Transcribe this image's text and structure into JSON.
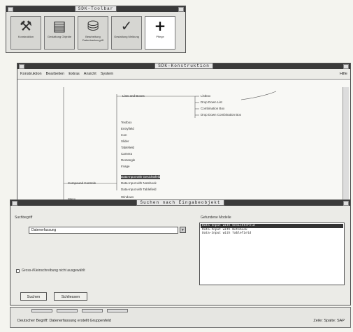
{
  "toolbar": {
    "title": "SDK-Toolbar",
    "tools": [
      {
        "label": "Konstruktion",
        "icon": "hammer-wrench-icon",
        "glyph": "⚒"
      },
      {
        "label": "Gestaltung Objekte",
        "icon": "notebook-icon",
        "glyph": "▤"
      },
      {
        "label": "Bearbeitung Datenbankzugriff",
        "icon": "disk-icon",
        "glyph": "⛁"
      },
      {
        "label": "Gestaltung Meldung",
        "icon": "check-icon",
        "glyph": "✓"
      },
      {
        "label": "Pflege",
        "icon": "plus-icon",
        "glyph": "+"
      }
    ]
  },
  "construction": {
    "title": "SDK-Konstruktion",
    "menu": [
      "Konstruktion",
      "Bearbeiten",
      "Extras",
      "Ansicht",
      "System"
    ],
    "help": "Hilfe",
    "tree": {
      "lists_and_boxes": "Lists and Boxes",
      "list_children": [
        "Listbox",
        "Drop Down List",
        "Combination Box",
        "Drop Down Combination Box"
      ],
      "controls": [
        "Textbox",
        "Entryfield",
        "Icon",
        "Slider",
        "Tablefield",
        "Camera",
        "Rectangle",
        "Image"
      ],
      "compound_controls": "Compound Controls",
      "compound_children": [
        "Data-Input with Gesichtsfeld",
        "Data-Input with Notebook",
        "Data-Input with Tablefield"
      ],
      "menu_label": "Menu",
      "menu_child": "Windows"
    }
  },
  "dialog": {
    "title": "Suchen nach Eingabeobjekt",
    "search_label": "Suchbegriff",
    "search_value": "Datenerfassung",
    "found_label": "Gefundene Modelle",
    "found_items": [
      "Data-Input with Gesichtsfeld",
      "Data-Input with Notebook",
      "Data-Input with Tablefield"
    ],
    "checkbox_label": "Gross-/Kleinschreibung nicht ausgewählt",
    "buttons": [
      "Suchen",
      "Schliessen"
    ]
  },
  "status": {
    "text": "Deutscher Begriff: Datenerfassung erstellt Gruppenfeld",
    "right": "Zeile: Spalte: SAP"
  }
}
